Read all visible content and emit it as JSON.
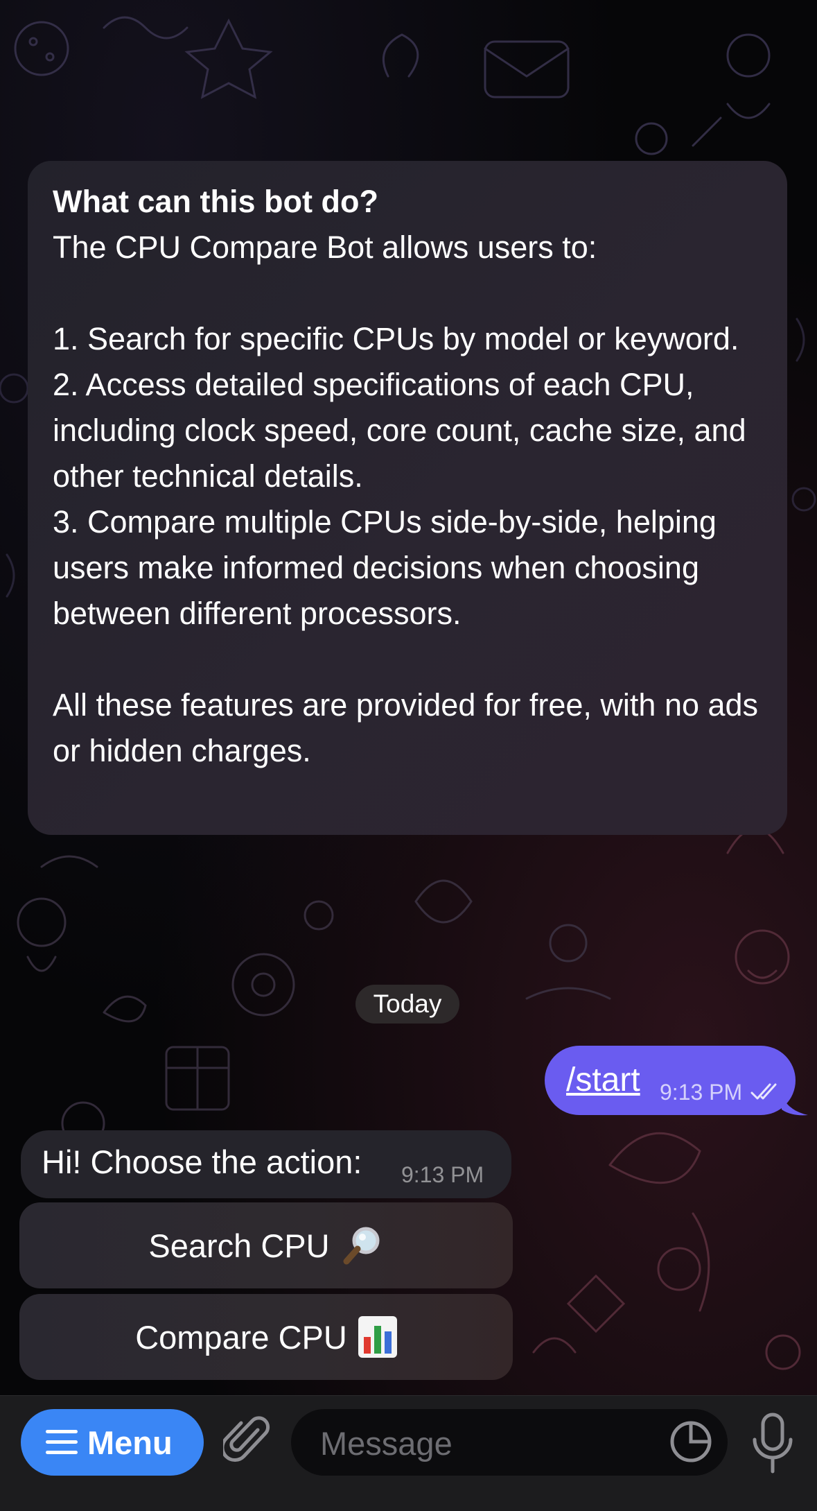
{
  "intro": {
    "title": "What can this bot do?",
    "body": "The CPU Compare Bot allows users to:\n\n1. Search for specific CPUs by model or keyword.\n2. Access detailed specifications of each CPU, including clock speed, core count, cache size, and other technical details.\n3. Compare multiple CPUs side-by-side, helping users make informed decisions when choosing between different processors.\n\nAll these features are provided for free, with no ads or hidden charges."
  },
  "date_divider": "Today",
  "messages": {
    "outgoing": {
      "text": "/start",
      "time": "9:13 PM",
      "status": "read"
    },
    "incoming": {
      "text": "Hi! Choose the action:",
      "time": "9:13 PM"
    }
  },
  "keyboard": {
    "buttons": [
      {
        "label": "Search CPU",
        "icon": "magnifying-glass-icon"
      },
      {
        "label": "Compare CPU",
        "icon": "bar-chart-icon"
      }
    ]
  },
  "composer": {
    "menu_label": "Menu",
    "placeholder": "Message"
  },
  "colors": {
    "outgoing_bubble": "#6a5cf0",
    "menu_button": "#3a86f5",
    "incoming_bubble": "#25242b"
  }
}
